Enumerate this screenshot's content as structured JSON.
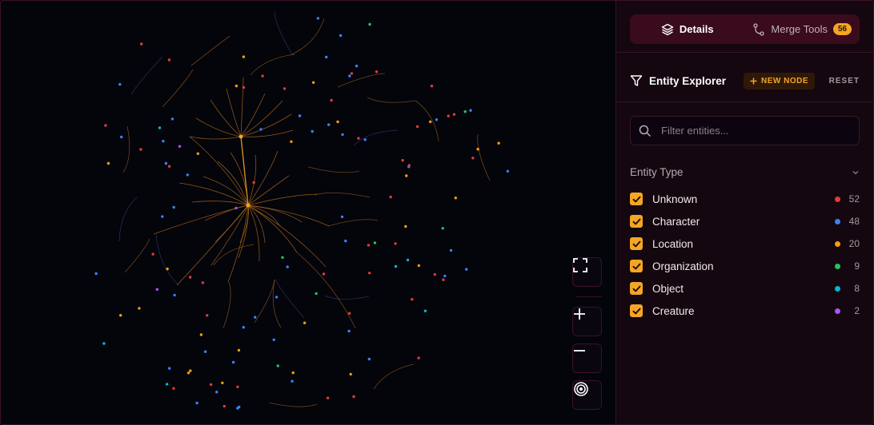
{
  "tabs": [
    {
      "label": "Details",
      "icon": "layers-icon",
      "active": true
    },
    {
      "label": "Merge Tools",
      "icon": "git-merge-icon",
      "badge": "56",
      "active": false
    }
  ],
  "explorer": {
    "title": "Entity Explorer",
    "new_node_label": "NEW NODE",
    "reset_label": "RESET"
  },
  "search": {
    "placeholder": "Filter entities...",
    "value": ""
  },
  "entity_type": {
    "title": "Entity Type",
    "items": [
      {
        "label": "Unknown",
        "count": "52",
        "color": "#e23b3b",
        "checked": true
      },
      {
        "label": "Character",
        "count": "48",
        "color": "#3b82f6",
        "checked": true
      },
      {
        "label": "Location",
        "count": "20",
        "color": "#f59e0b",
        "checked": true
      },
      {
        "label": "Organization",
        "count": "9",
        "color": "#22c55e",
        "checked": true
      },
      {
        "label": "Object",
        "count": "8",
        "color": "#06b6d4",
        "checked": true
      },
      {
        "label": "Creature",
        "count": "2",
        "color": "#a855f7",
        "checked": true
      }
    ]
  },
  "graph_controls": [
    "fullscreen-icon",
    "zoom-in-icon",
    "zoom-out-icon",
    "target-icon"
  ],
  "colors": {
    "accent": "#f5a524",
    "edge": "#b8701a",
    "background": "#04040b"
  }
}
